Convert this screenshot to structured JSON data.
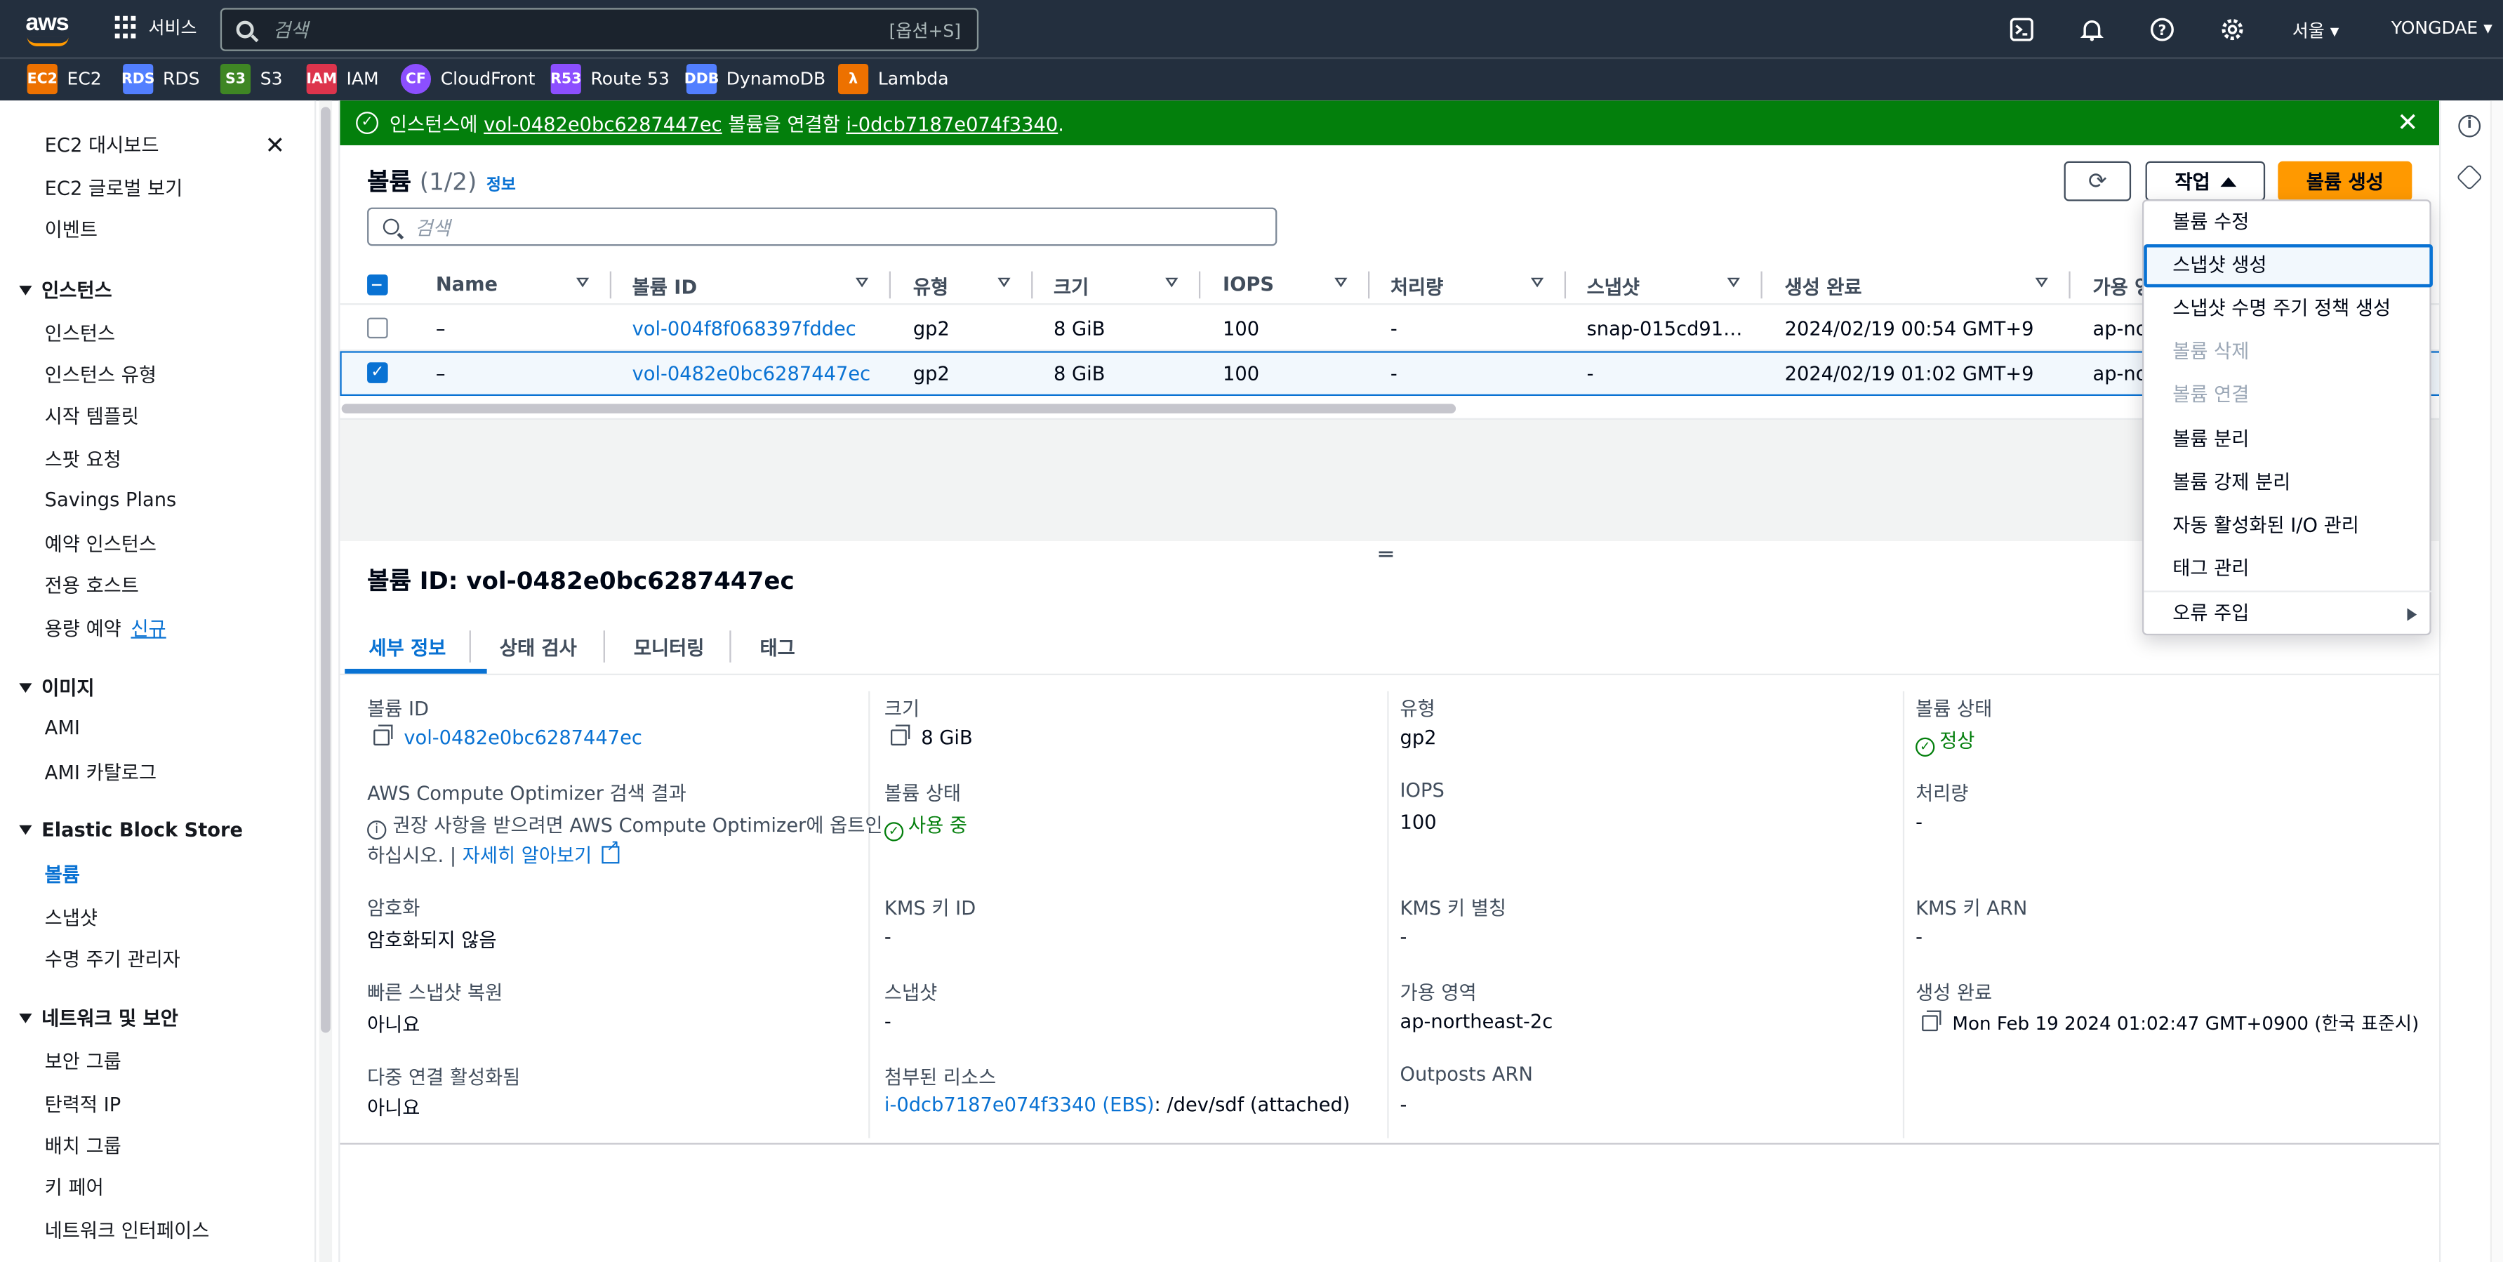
{
  "topnav": {
    "logo_text": "aws",
    "services_label": "서비스",
    "search_placeholder": "검색",
    "search_shortcut": "[옵션+S]",
    "region": "서울 ▾",
    "user": "YONGDAE ▾",
    "icons": [
      "cloudshell-icon",
      "bell-icon",
      "help-icon",
      "gear-icon"
    ]
  },
  "favorites": [
    {
      "label": "EC2",
      "color": "#ed7100",
      "abbr": "EC2"
    },
    {
      "label": "RDS",
      "color": "#527fff",
      "abbr": "RDS"
    },
    {
      "label": "S3",
      "color": "#3f8624",
      "abbr": "S3"
    },
    {
      "label": "IAM",
      "color": "#dd344c",
      "abbr": "IAM"
    },
    {
      "label": "CloudFront",
      "color": "#8c4fff",
      "abbr": "CF"
    },
    {
      "label": "Route 53",
      "color": "#8c4fff",
      "abbr": "R53"
    },
    {
      "label": "DynamoDB",
      "color": "#527fff",
      "abbr": "DDB"
    },
    {
      "label": "Lambda",
      "color": "#ed7100",
      "abbr": "λ"
    }
  ],
  "sidebar": {
    "top_items": [
      "EC2 대시보드",
      "EC2 글로벌 보기",
      "이벤트"
    ],
    "sections": [
      {
        "title": "인스턴스",
        "items": [
          "인스턴스",
          "인스턴스 유형",
          "시작 템플릿",
          "스팟 요청",
          "Savings Plans",
          "예약 인스턴스",
          "전용 호스트",
          "용량 예약"
        ]
      },
      {
        "title": "이미지",
        "items": [
          "AMI",
          "AMI 카탈로그"
        ]
      },
      {
        "title": "Elastic Block Store",
        "items": [
          "볼륨",
          "스냅샷",
          "수명 주기 관리자"
        ]
      },
      {
        "title": "네트워크 및 보안",
        "items": [
          "보안 그룹",
          "탄력적 IP",
          "배치 그룹",
          "키 페어",
          "네트워크 인터페이스"
        ]
      }
    ],
    "new_badge": "신규",
    "active_item": "볼륨"
  },
  "flash": {
    "prefix": "인스턴스에 ",
    "volume": "vol-0482e0bc6287447ec",
    "middle": " 볼륨을 연결함 ",
    "instance": "i-0dcb7187e074f3340",
    "suffix": "."
  },
  "panel": {
    "title": "볼륨",
    "count": "(1/2)",
    "info": "정보",
    "actions_label": "작업",
    "create_label": "볼륨 생성",
    "search_placeholder": "검색"
  },
  "table": {
    "headers": [
      "Name",
      "볼륨 ID",
      "유형",
      "크기",
      "IOPS",
      "처리량",
      "스냅샷",
      "생성 완료",
      "가용 영"
    ],
    "rows": [
      {
        "name": "–",
        "volume_id": "vol-004f8f068397fddec",
        "type": "gp2",
        "size": "8 GiB",
        "iops": "100",
        "throughput": "-",
        "snapshot": "snap-015cd91…",
        "created": "2024/02/19 00:54 GMT+9",
        "az": "ap-no",
        "selected": false
      },
      {
        "name": "–",
        "volume_id": "vol-0482e0bc6287447ec",
        "type": "gp2",
        "size": "8 GiB",
        "iops": "100",
        "throughput": "-",
        "snapshot": "-",
        "created": "2024/02/19 01:02 GMT+9",
        "az": "ap-no",
        "selected": true
      }
    ]
  },
  "details": {
    "title": "볼륨 ID: vol-0482e0bc6287447ec",
    "tabs": [
      "세부 정보",
      "상태 검사",
      "모니터링",
      "태그"
    ],
    "fields": {
      "volume_id_label": "볼륨 ID",
      "volume_id": "vol-0482e0bc6287447ec",
      "size_label": "크기",
      "size": "8 GiB",
      "type_label": "유형",
      "type": "gp2",
      "vol_status_label": "볼륨 상태",
      "vol_status": "정상",
      "optimizer_label": "AWS Compute Optimizer 검색 결과",
      "optimizer_text1": "권장 사항을 받으려면 AWS Compute Optimizer에 옵트인",
      "optimizer_text2": "하십시오. | ",
      "optimizer_link": "자세히 알아보기",
      "state_label": "볼륨 상태",
      "state": "사용 중",
      "iops_label": "IOPS",
      "iops": "100",
      "throughput_label": "처리량",
      "throughput": "-",
      "encryption_label": "암호화",
      "encryption": "암호화되지 않음",
      "kms_id_label": "KMS 키 ID",
      "kms_id": "-",
      "kms_alias_label": "KMS 키 별칭",
      "kms_alias": "-",
      "kms_arn_label": "KMS 키 ARN",
      "kms_arn": "-",
      "fast_restore_label": "빠른 스냅샷 복원",
      "fast_restore": "아니요",
      "snapshot_label": "스냅샷",
      "snapshot": "-",
      "az_label": "가용 영역",
      "az": "ap-northeast-2c",
      "created_label": "생성 완료",
      "created": "Mon Feb 19 2024 01:02:47 GMT+0900 (한국 표준시)",
      "multi_attach_label": "다중 연결 활성화됨",
      "multi_attach": "아니요",
      "attached_label": "첨부된 리소스",
      "attached_link": "i-0dcb7187e074f3340 (EBS)",
      "attached_suffix": ": /dev/sdf (attached)",
      "outposts_label": "Outposts ARN",
      "outposts": "-"
    }
  },
  "action_menu": {
    "items": [
      {
        "label": "볼륨 수정",
        "disabled": false
      },
      {
        "label": "스냅샷 생성",
        "disabled": false,
        "highlighted": true
      },
      {
        "label": "스냅샷 수명 주기 정책 생성",
        "disabled": false
      },
      {
        "label": "볼륨 삭제",
        "disabled": true
      },
      {
        "label": "볼륨 연결",
        "disabled": true
      },
      {
        "label": "볼륨 분리",
        "disabled": false
      },
      {
        "label": "볼륨 강제 분리",
        "disabled": false
      },
      {
        "label": "자동 활성화된 I/O 관리",
        "disabled": false
      },
      {
        "label": "태그 관리",
        "disabled": false
      },
      {
        "label": "오류 주입",
        "disabled": false,
        "submenu": true
      }
    ]
  }
}
